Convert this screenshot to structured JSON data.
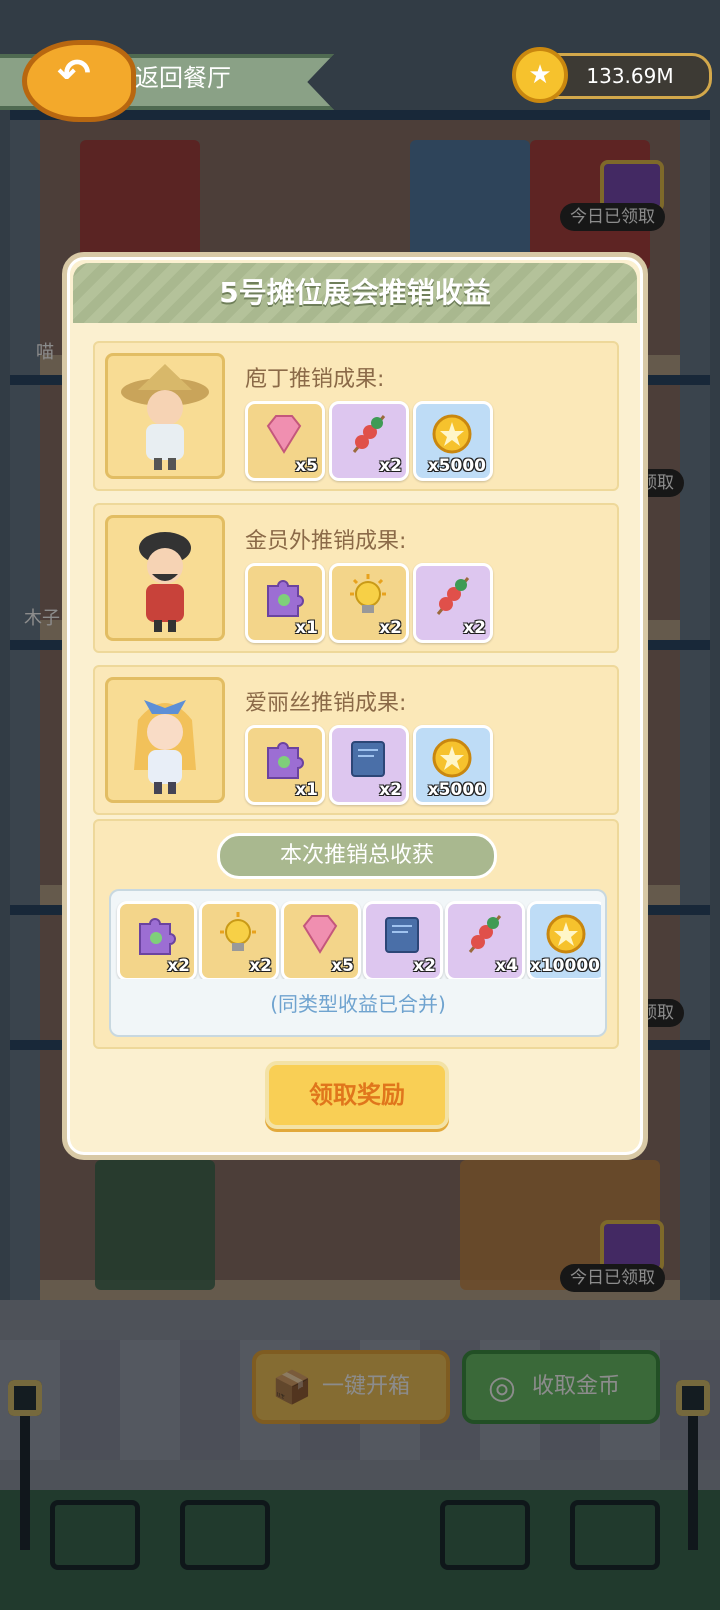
{
  "top_bar": {
    "back_label": "返回餐厅",
    "coin_value": "133.69M"
  },
  "background": {
    "claimed_badge": "今日已领取",
    "claimed_badge_partial": "领取",
    "name_fragment_1": "喵",
    "name_fragment_2": "木子",
    "bottom_buttons": {
      "open_all": "一键开箱",
      "collect_coins": "收取金币"
    }
  },
  "dialog": {
    "title": "5号摊位展会推销收益",
    "rows": [
      {
        "label": "庖丁推销成果:",
        "items": [
          {
            "icon": "gem-icon",
            "count": "x5",
            "bg": "orange"
          },
          {
            "icon": "skewer-icon",
            "count": "x2",
            "bg": "purple"
          },
          {
            "icon": "coin-icon",
            "count": "x5000",
            "bg": "blue"
          }
        ]
      },
      {
        "label": "金员外推销成果:",
        "items": [
          {
            "icon": "puzzle-piece-icon",
            "count": "x1",
            "bg": "orange"
          },
          {
            "icon": "lightbulb-icon",
            "count": "x2",
            "bg": "orange"
          },
          {
            "icon": "skewer-icon",
            "count": "x2",
            "bg": "purple"
          }
        ]
      },
      {
        "label": "爱丽丝推销成果:",
        "items": [
          {
            "icon": "puzzle-piece-icon",
            "count": "x1",
            "bg": "orange"
          },
          {
            "icon": "blue-book-icon",
            "count": "x2",
            "bg": "purple"
          },
          {
            "icon": "coin-icon",
            "count": "x5000",
            "bg": "blue"
          }
        ]
      }
    ],
    "total": {
      "tag": "本次推销总收获",
      "items": [
        {
          "icon": "puzzle-piece-icon",
          "count": "x2",
          "bg": "orange"
        },
        {
          "icon": "lightbulb-icon",
          "count": "x2",
          "bg": "orange"
        },
        {
          "icon": "gem-icon",
          "count": "x5",
          "bg": "orange"
        },
        {
          "icon": "blue-book-icon",
          "count": "x2",
          "bg": "purple"
        },
        {
          "icon": "skewer-icon",
          "count": "x4",
          "bg": "purple"
        },
        {
          "icon": "coin-icon",
          "count": "x10000",
          "bg": "blue"
        }
      ],
      "merged_note": "(同类型收益已合并)"
    },
    "claim_button": "领取奖励"
  },
  "colors": {
    "accent_green": "#a9b88f",
    "dialog_bg": "#fbf0d0",
    "claim_button": "#f9cf55"
  }
}
